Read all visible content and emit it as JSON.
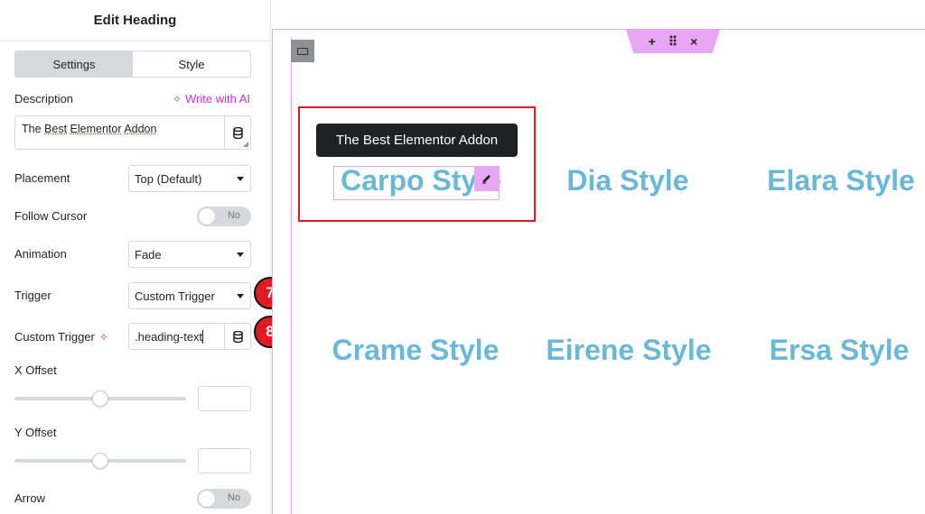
{
  "panel": {
    "title": "Edit Heading",
    "tabs": [
      {
        "label": "Settings",
        "active": true
      },
      {
        "label": "Style",
        "active": false
      }
    ],
    "description": {
      "label": "Description",
      "ai_link": "Write with AI",
      "value_words": [
        "The",
        "Best",
        "Elementor",
        "Addon"
      ]
    },
    "placement": {
      "label": "Placement",
      "value": "Top (Default)"
    },
    "follow_cursor": {
      "label": "Follow Cursor",
      "toggle": "No"
    },
    "animation": {
      "label": "Animation",
      "value": "Fade"
    },
    "trigger": {
      "label": "Trigger",
      "value": "Custom Trigger"
    },
    "custom_trigger": {
      "label": "Custom Trigger",
      "value": ".heading-text"
    },
    "x_offset": {
      "label": "X Offset",
      "slider_fraction": 0.5
    },
    "y_offset": {
      "label": "Y Offset",
      "slider_fraction": 0.5
    },
    "arrow": {
      "label": "Arrow",
      "toggle": "No"
    }
  },
  "badges": {
    "seven": "7",
    "eight": "8"
  },
  "canvas": {
    "toolbar": {
      "add": "+",
      "drag": "⠿",
      "close": "×"
    },
    "tooltip": "The Best Elementor Addon",
    "headings": [
      "Carpo Style",
      "Dia Style",
      "Elara Style",
      "Crame Style",
      "Eirene Style",
      "Ersa Style"
    ]
  },
  "colors": {
    "accent": "#c036d1",
    "heading": "#6ab7d8",
    "badge": "#e01b24",
    "selection": "#e9a6f5"
  }
}
